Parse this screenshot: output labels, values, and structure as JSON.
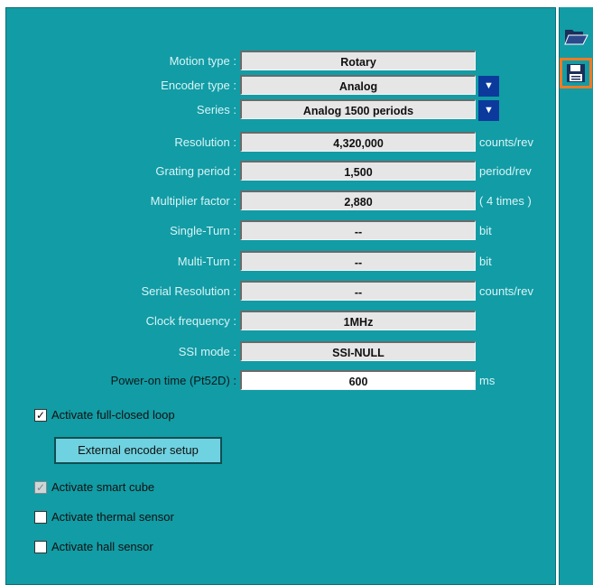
{
  "fields": [
    {
      "label": "Motion type :",
      "value": "Rotary",
      "unit": "",
      "dropdown": false,
      "white": false
    },
    {
      "label": "Encoder type :",
      "value": "Analog",
      "unit": "",
      "dropdown": true,
      "white": false
    },
    {
      "label": "Series :",
      "value": "Analog 1500 periods",
      "unit": "",
      "dropdown": true,
      "white": false
    },
    {
      "label": "Resolution :",
      "value": "4,320,000",
      "unit": "counts/rev",
      "dropdown": false,
      "white": false
    },
    {
      "label": "Grating period :",
      "value": "1,500",
      "unit": "period/rev",
      "dropdown": false,
      "white": false
    },
    {
      "label": "Multiplier factor :",
      "value": "2,880",
      "unit": "( 4 times )",
      "dropdown": false,
      "white": false
    },
    {
      "label": "Single-Turn :",
      "value": "--",
      "unit": "bit",
      "dropdown": false,
      "white": false
    },
    {
      "label": "Multi-Turn :",
      "value": "--",
      "unit": "bit",
      "dropdown": false,
      "white": false
    },
    {
      "label": "Serial Resolution :",
      "value": "--",
      "unit": "counts/rev",
      "dropdown": false,
      "white": false
    },
    {
      "label": "Clock frequency :",
      "value": "1MHz",
      "unit": "",
      "dropdown": false,
      "white": false
    },
    {
      "label": "SSI mode :",
      "value": "SSI-NULL",
      "unit": "",
      "dropdown": false,
      "white": false
    },
    {
      "label": "Power-on time (Pt52D) :",
      "value": "600",
      "unit": "ms",
      "dropdown": false,
      "white": true
    }
  ],
  "checkboxes": [
    {
      "label": "Activate full-closed loop",
      "checked": true,
      "disabled": false
    },
    {
      "label": "Activate smart cube",
      "checked": true,
      "disabled": true
    },
    {
      "label": "Activate thermal sensor",
      "checked": false,
      "disabled": false
    },
    {
      "label": "Activate hall sensor",
      "checked": false,
      "disabled": false
    }
  ],
  "external_button": "External encoder setup",
  "dropdown_glyph": "▼",
  "check_glyph": "✓",
  "toolbar": {
    "open_icon": "folder-open-icon",
    "save_icon": "save-icon",
    "selected_color": "#f07a23"
  },
  "colors": {
    "panel": "#129ca5",
    "dropdown": "#0b3a9c",
    "button": "#6fd2e0"
  }
}
